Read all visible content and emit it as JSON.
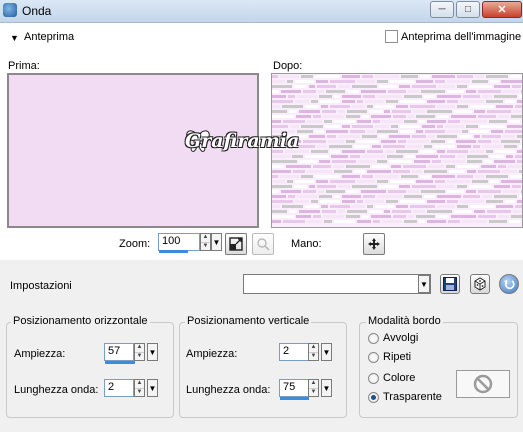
{
  "window": {
    "title": "Onda",
    "minimize_glyph": "─",
    "maximize_glyph": "□",
    "close_glyph": "✕",
    "app_icon": "app-icon"
  },
  "preview": {
    "toggle_label": "Anteprima",
    "image_preview_checkbox_label": "Anteprima dell'immagine",
    "image_preview_checked": false,
    "before_label": "Prima:",
    "after_label": "Dopo:",
    "watermark_text": "Grafiramia",
    "before_color": "#f2dcf3"
  },
  "zoom": {
    "label": "Zoom:",
    "value": "100",
    "pan_label": "Mano:"
  },
  "settings": {
    "label": "Impostazioni",
    "preset_value": ""
  },
  "horizontal": {
    "title": "Posizionamento orizzontale",
    "amplitude_label": "Ampiezza:",
    "amplitude_value": "57",
    "wavelength_label": "Lunghezza onda:",
    "wavelength_value": "2"
  },
  "vertical": {
    "title": "Posizionamento verticale",
    "amplitude_label": "Ampiezza:",
    "amplitude_value": "2",
    "wavelength_label": "Lunghezza onda:",
    "wavelength_value": "75"
  },
  "edge_mode": {
    "title": "Modalità bordo",
    "options": [
      {
        "label": "Avvolgi",
        "selected": false
      },
      {
        "label": "Ripeti",
        "selected": false
      },
      {
        "label": "Colore",
        "selected": false
      },
      {
        "label": "Trasparente",
        "selected": true
      }
    ]
  },
  "colors": {
    "accent": "#3b8ce1",
    "preview_pink": "#f2dcf3",
    "close_red": "#c8422b"
  }
}
